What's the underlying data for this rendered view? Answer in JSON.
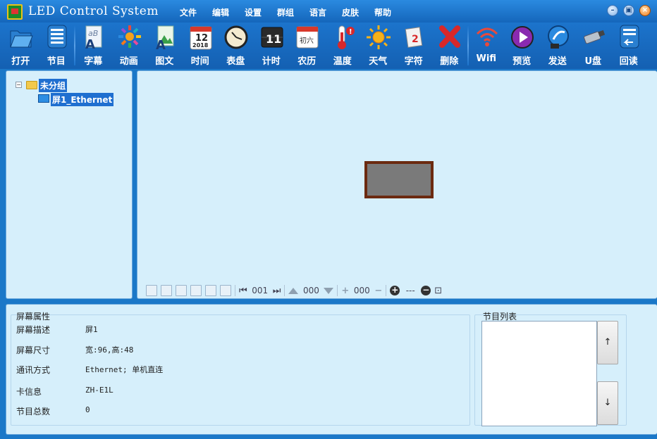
{
  "window": {
    "title": "LED Control System",
    "menu": [
      "文件",
      "编辑",
      "设置",
      "群组",
      "语言",
      "皮肤",
      "帮助"
    ]
  },
  "toolbar": {
    "items": [
      {
        "label": "打开",
        "icon": "open-folder-icon"
      },
      {
        "label": "节目",
        "icon": "program-icon"
      },
      {
        "label": "字幕",
        "icon": "subtitle-icon"
      },
      {
        "label": "动画",
        "icon": "animation-icon"
      },
      {
        "label": "图文",
        "icon": "image-text-icon"
      },
      {
        "label": "时间",
        "icon": "calendar-icon"
      },
      {
        "label": "表盘",
        "icon": "clock-icon"
      },
      {
        "label": "计时",
        "icon": "timer-icon"
      },
      {
        "label": "农历",
        "icon": "lunar-calendar-icon"
      },
      {
        "label": "温度",
        "icon": "thermometer-icon"
      },
      {
        "label": "天气",
        "icon": "sun-icon"
      },
      {
        "label": "字符",
        "icon": "character-icon"
      },
      {
        "label": "删除",
        "icon": "delete-icon"
      },
      {
        "label": "Wifi",
        "icon": "wifi-icon"
      },
      {
        "label": "预览",
        "icon": "preview-icon"
      },
      {
        "label": "发送",
        "icon": "send-icon"
      },
      {
        "label": "U盘",
        "icon": "usb-icon"
      },
      {
        "label": "回读",
        "icon": "readback-icon"
      }
    ],
    "calendar_day": "12",
    "calendar_year": "2018",
    "timer_digits": "11",
    "lunar_text": "初六"
  },
  "tree": {
    "group_label": "未分组",
    "screen_label": "屏1_Ethernet",
    "expander": "−"
  },
  "canvas_toolbar": {
    "program_index": "001",
    "area_index": "000",
    "item_index": "000",
    "zoom": "---"
  },
  "properties": {
    "title": "屏幕属性",
    "rows": [
      {
        "label": "屏幕描述",
        "value": "屏1"
      },
      {
        "label": "屏幕尺寸",
        "value": "宽:96,高:48"
      },
      {
        "label": "通讯方式",
        "value": "Ethernet; 单机直连"
      },
      {
        "label": "卡信息",
        "value": "ZH-E1L"
      },
      {
        "label": "节目总数",
        "value": "0"
      }
    ]
  },
  "program_list": {
    "title": "节目列表",
    "up": "↑",
    "down": "↓"
  },
  "colors": {
    "titlebar": "#1566bb",
    "panel_bg": "#d6effb",
    "selection": "#1f6fd0",
    "screen_frame": "#6b2a10",
    "screen_fill": "#7a7a7a"
  }
}
